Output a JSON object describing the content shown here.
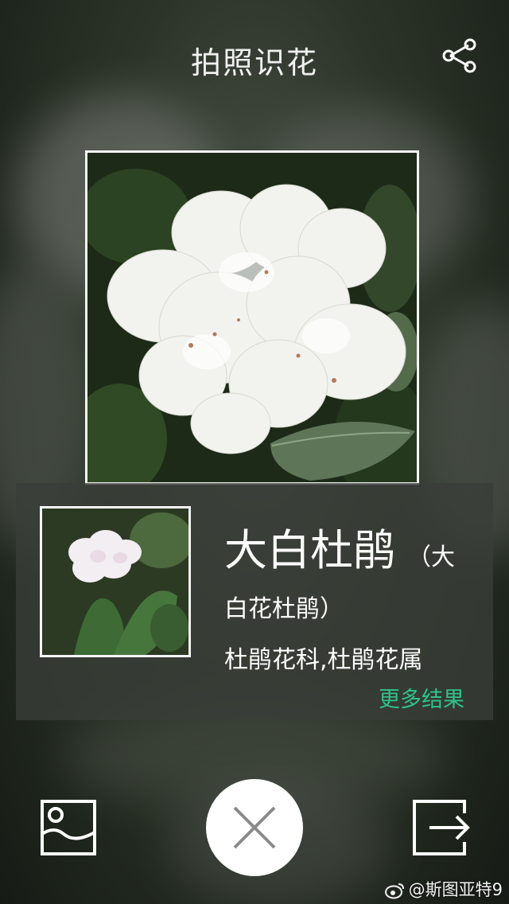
{
  "header": {
    "title": "拍照识花"
  },
  "icons": {
    "share": "share-icon",
    "gallery": "image-gallery-icon",
    "close": "close-icon",
    "exit": "exit-arrow-icon",
    "weibo": "weibo-icon"
  },
  "photo": {
    "subject": "white rhododendron flowers"
  },
  "result": {
    "name_main": "大白杜鹃",
    "name_alt_part1": "（大",
    "name_alt_part2": "白花杜鹃）",
    "family": "杜鹃花科,杜鹃花属",
    "more_label": "更多结果"
  },
  "watermark": {
    "text": "@斯图亚特9"
  },
  "colors": {
    "accent": "#2fc38a",
    "frame": "#f4f4f4"
  }
}
